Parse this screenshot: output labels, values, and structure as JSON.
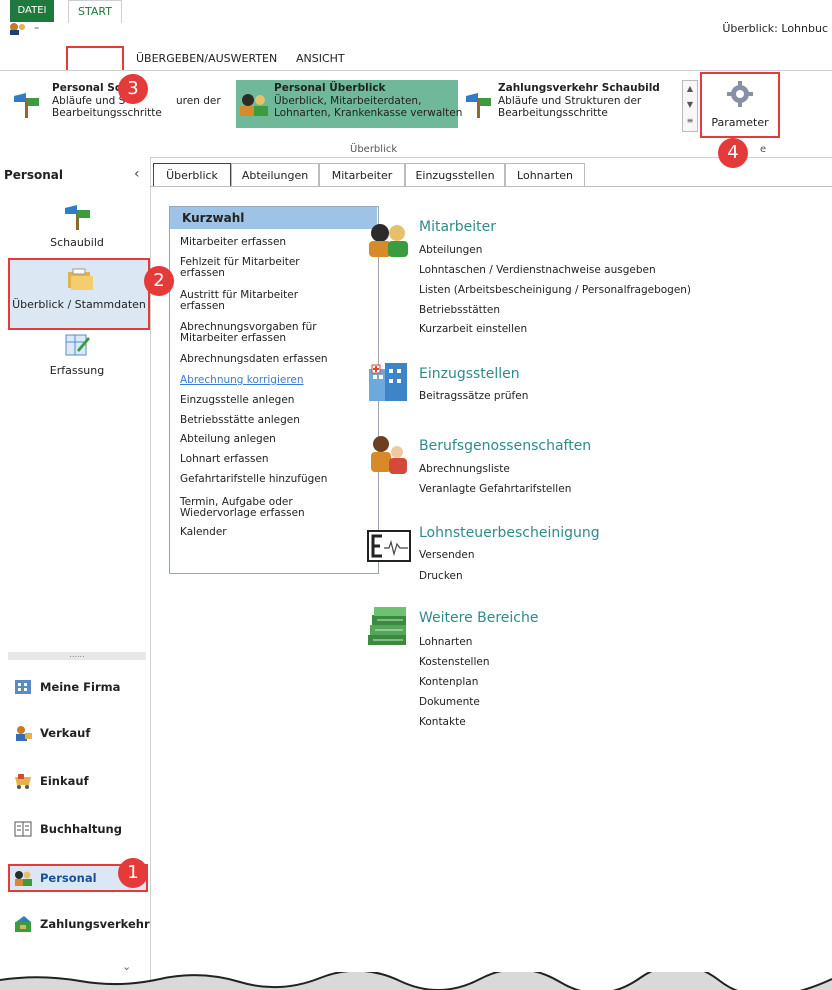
{
  "window": {
    "title": "Überblick: Lohnbuc"
  },
  "ribbon": {
    "tabs": [
      "DATEI",
      "START",
      "ÜBERGEBEN/AUSWERTEN",
      "ANSICHT"
    ],
    "gallery": [
      {
        "title": "Personal Sch",
        "desc1": "Abläufe und S",
        "desc1b": "uren der",
        "desc2": "Bearbeitungsschritte"
      },
      {
        "title": "Personal Überblick",
        "desc1": "Überblick, Mitarbeiterdaten,",
        "desc2": "Lohnarten, Krankenkasse verwalten"
      },
      {
        "title": "Zahlungsverkehr Schaubild",
        "desc1": "Abläufe und Strukturen der",
        "desc2": "Bearbeitungsschritte"
      }
    ],
    "group_label": "Überblick",
    "parameter_label": "Parameter",
    "group_label2": "e"
  },
  "nav": {
    "header": "Personal",
    "big_items": [
      "Schaubild",
      "Überblick / Stammdaten",
      "Erfassung"
    ],
    "modules": [
      "Meine Firma",
      "Verkauf",
      "Einkauf",
      "Buchhaltung",
      "Personal",
      "Zahlungsverkehr"
    ]
  },
  "content_tabs": [
    "Überblick",
    "Abteilungen",
    "Mitarbeiter",
    "Einzugsstellen",
    "Lohnarten"
  ],
  "kurzwahl": {
    "title": "Kurzwahl",
    "items": [
      [
        "Mitarbeiter erfassen"
      ],
      [
        "Fehlzeit für Mitarbeiter",
        "erfassen"
      ],
      [
        "Austritt für Mitarbeiter",
        "erfassen"
      ],
      [
        "Abrechnungsvorgaben für",
        "Mitarbeiter erfassen"
      ],
      [
        "Abrechnungsdaten erfassen"
      ],
      [
        "Abrechnung korrigieren"
      ],
      [
        "Einzugsstelle anlegen"
      ],
      [
        "Betriebsstätte anlegen"
      ],
      [
        "Abteilung anlegen"
      ],
      [
        "Lohnart erfassen"
      ],
      [
        "Gefahrtarifstelle hinzufügen"
      ],
      [
        "Termin, Aufgabe oder",
        "Wiedervorlage erfassen"
      ],
      [
        "Kalender"
      ]
    ]
  },
  "sections": [
    {
      "title": "Mitarbeiter",
      "links": [
        "Abteilungen",
        "Lohntaschen / Verdienstnachweise ausgeben",
        "Listen (Arbeitsbescheinigung / Personalfragebogen)",
        "Betriebsstätten",
        "Kurzarbeit einstellen"
      ]
    },
    {
      "title": "Einzugsstellen",
      "links": [
        "Beitragssätze prüfen"
      ]
    },
    {
      "title": "Berufsgenossenschaften",
      "links": [
        "Abrechnungsliste",
        "Veranlagte Gefahrtarifstellen"
      ]
    },
    {
      "title": "Lohnsteuerbescheinigung",
      "links": [
        "Versenden",
        "Drucken"
      ]
    },
    {
      "title": "Weitere Bereiche",
      "links": [
        "Lohnarten",
        "Kostenstellen",
        "Kontenplan",
        "Dokumente",
        "Kontakte"
      ]
    }
  ],
  "badges": [
    "1",
    "2",
    "3",
    "4"
  ],
  "colors": {
    "accent_green": "#1e7a3c",
    "highlight_red": "#e53a3a",
    "selected_gallery": "#6fb99a",
    "section_title": "#2e8b8b"
  }
}
